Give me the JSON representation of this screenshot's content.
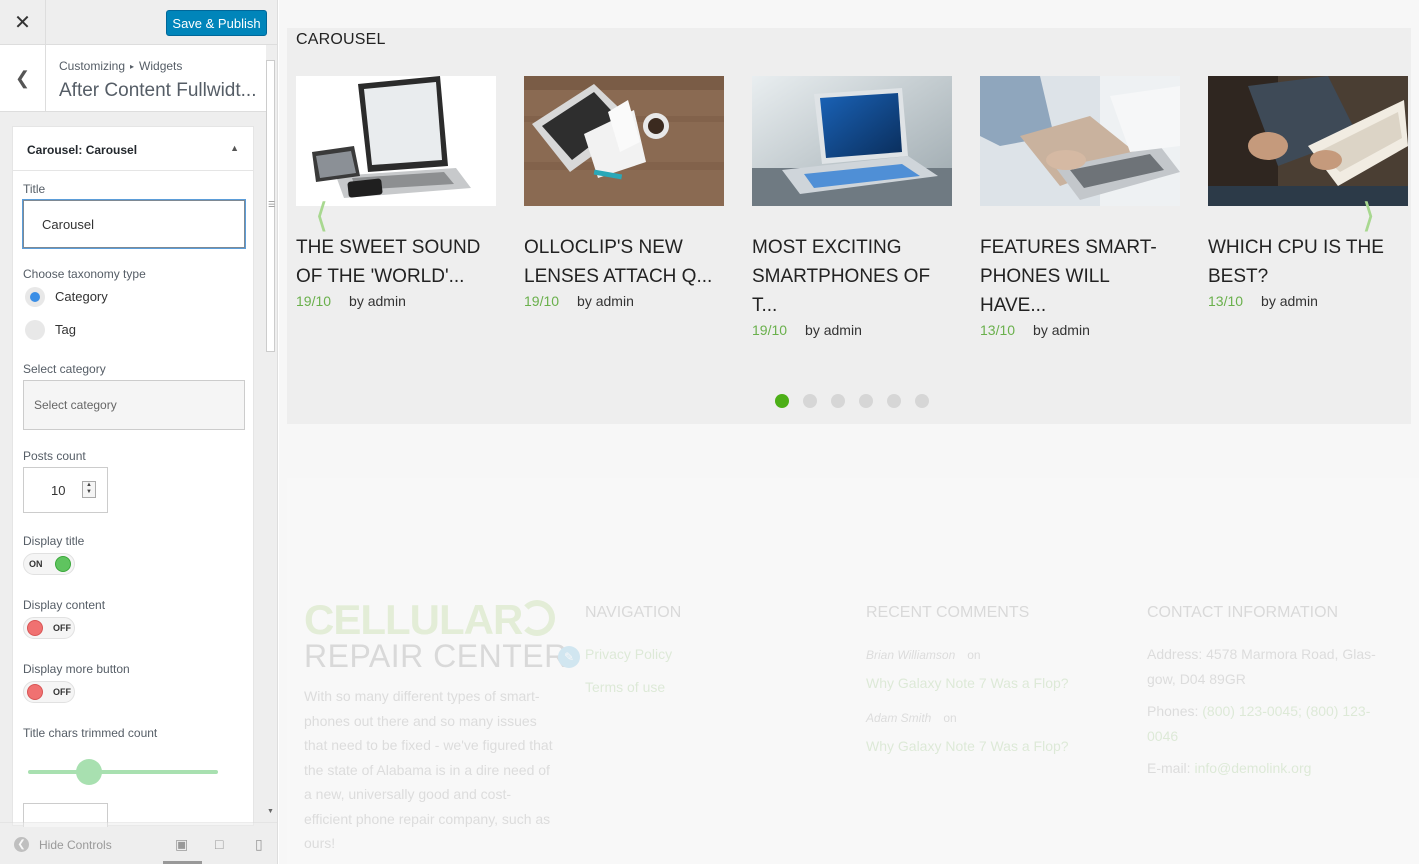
{
  "header": {
    "close_label": "✕",
    "save_publish": "Save & Publish"
  },
  "section": {
    "breadcrumb_root": "Customizing",
    "breadcrumb_sep": "▸",
    "breadcrumb_child": "Widgets",
    "title": "After Content Fullwidt..."
  },
  "widget": {
    "title_prefix": "Carousel:",
    "title_name": "Carousel",
    "fields": {
      "title_label": "Title",
      "title_value": "Carousel",
      "taxonomy_label": "Choose taxonomy type",
      "taxonomy_options": [
        "Category",
        "Tag"
      ],
      "taxonomy_selected": "Category",
      "category_label": "Select category",
      "category_placeholder": "Select category",
      "posts_count_label": "Posts count",
      "posts_count_value": "10",
      "display_title_label": "Display title",
      "display_title_state": "ON",
      "display_content_label": "Display content",
      "display_content_state": "OFF",
      "display_more_label": "Display more button",
      "display_more_state": "OFF",
      "trim_label": "Title chars trimmed count",
      "trim_slider_fraction": 0.32
    }
  },
  "footer_controls": {
    "hide_label": "Hide Controls",
    "devices": [
      "desktop",
      "tablet",
      "mobile"
    ],
    "active_device": "desktop"
  },
  "carousel": {
    "heading": "CAROUSEL",
    "posts": [
      {
        "title_line1": "THE SWEET SOUND",
        "title_line2": "OF THE 'WORLD'...",
        "title_line3": "",
        "date": "19/10",
        "author": "by admin",
        "image": "laptop-tablet-phone"
      },
      {
        "title_line1": "OLLOCLIP'S NEW",
        "title_line2": "LENSES ATTACH Q...",
        "title_line3": "",
        "date": "19/10",
        "author": "by admin",
        "image": "laptop-notebook-coffee-desk"
      },
      {
        "title_line1": "MOST EXCITING",
        "title_line2": "SMARTPHONES OF",
        "title_line3": "T...",
        "date": "19/10",
        "author": "by admin",
        "image": "laptop-on-table"
      },
      {
        "title_line1": "FEATURES SMART-",
        "title_line2": "PHONES WILL HAVE...",
        "title_line3": "",
        "date": "13/10",
        "author": "by admin",
        "image": "hands-typing-laptop"
      },
      {
        "title_line1": "WHICH CPU IS THE",
        "title_line2": "BEST?",
        "title_line3": "",
        "date": "13/10",
        "author": "by admin",
        "image": "person-reading-book"
      }
    ],
    "dot_count": 6,
    "active_dot": 0,
    "colors": {
      "accent": "#4caf17",
      "date": "#6ab04c"
    }
  },
  "site_footer": {
    "logo_main": "CELLULAR",
    "logo_sub": "REPAIR CENTER",
    "about": "With so many different types of smart-phones out there and so many issues that need to be fixed - we've figured that the state of Alabama is in a dire need of a new, universally good and cost-efficient phone repair company, such as ours!",
    "nav_title": "NAVIGATION",
    "nav_links": [
      "Privacy Policy",
      "Terms of use"
    ],
    "comments_title": "RECENT COMMENTS",
    "comments": [
      {
        "author": "Brian Williamson",
        "on": "on",
        "post": "Why Galaxy Note 7 Was a Flop?"
      },
      {
        "author": "Adam Smith",
        "on": "on",
        "post": "Why Galaxy Note 7 Was a Flop?"
      }
    ],
    "contact_title": "CONTACT INFORMATION",
    "address_label": "Address:",
    "address": "4578 Marmora Road, Glas-gow, D04 89GR",
    "phones_label": "Phones:",
    "phones": "(800) 123-0045; (800) 123-0046",
    "email_label": "E-mail:",
    "email": "info@demolink.org"
  }
}
